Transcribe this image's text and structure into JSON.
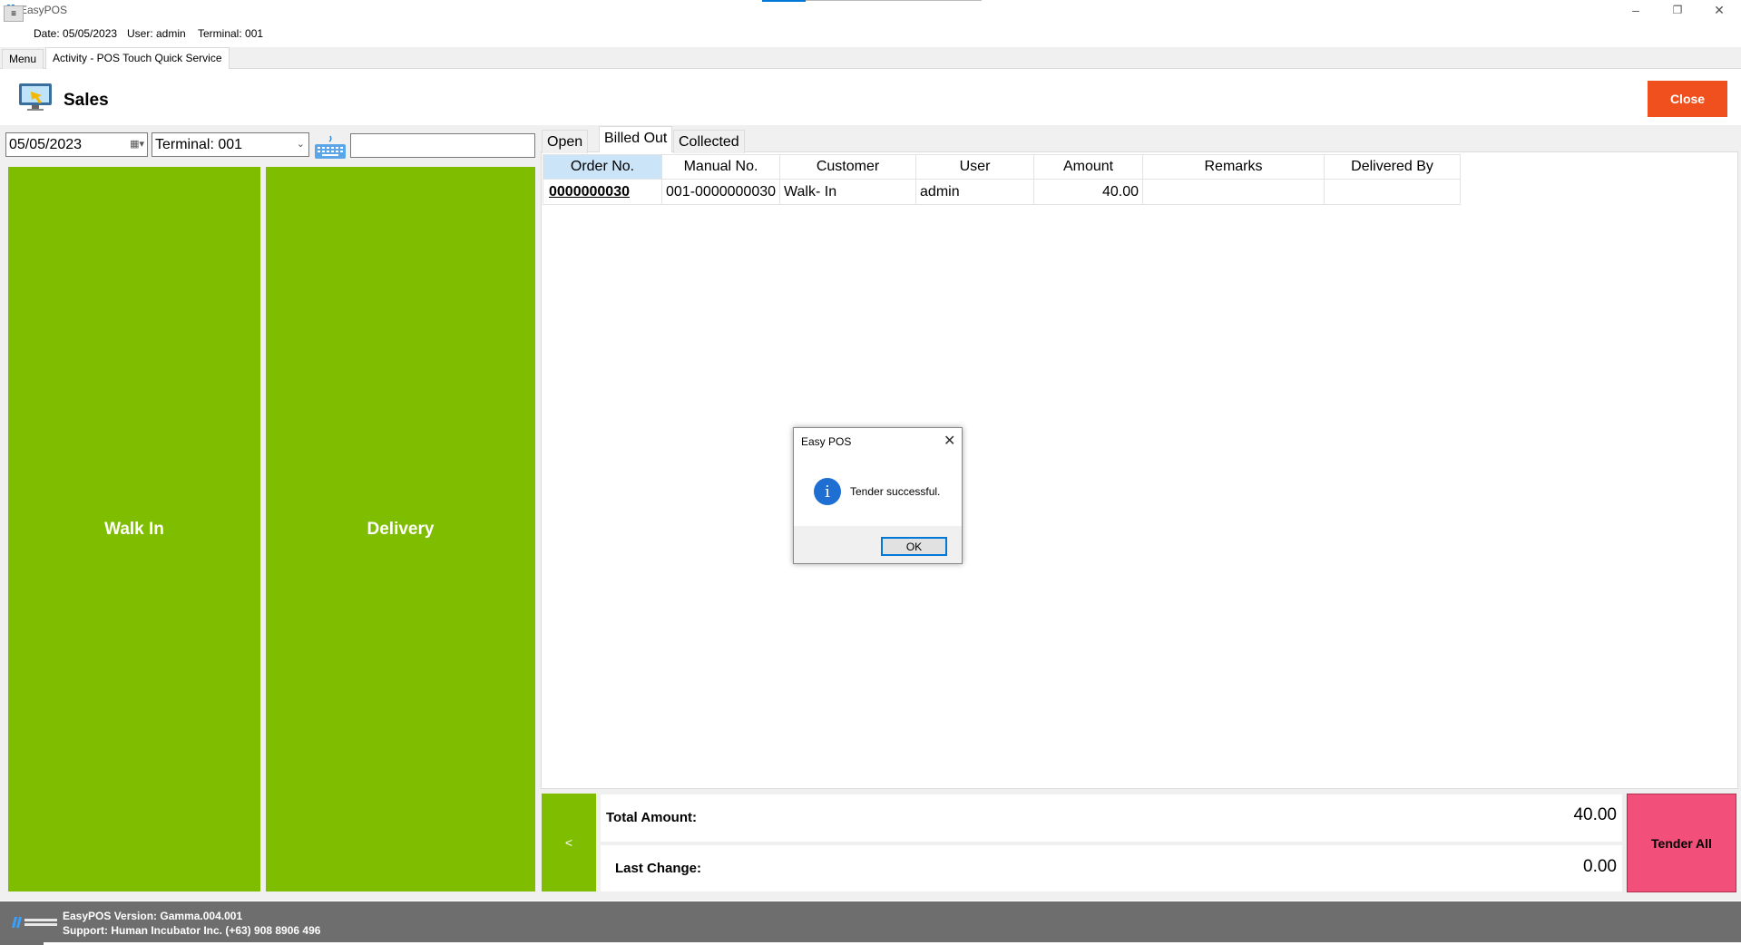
{
  "window": {
    "app_title": "EasyPOS",
    "controls": [
      "–",
      "❐",
      "✕"
    ]
  },
  "infobar": {
    "menu_glyph": "≡",
    "date": "Date: 05/05/2023",
    "user": "User: admin",
    "terminal": "Terminal: 001"
  },
  "tabs": {
    "menu": "Menu",
    "activity": "Activity - POS Touch Quick Service"
  },
  "sales": {
    "title": "Sales",
    "close_label": "Close",
    "date_value": "05/05/2023",
    "terminal_value": "Terminal: 001",
    "search_value": "",
    "walk_in_label": "Walk In",
    "delivery_label": "Delivery"
  },
  "order_tabs": {
    "open": "Open",
    "billed_out": "Billed Out",
    "collected": "Collected"
  },
  "table": {
    "headers": [
      "Order No.",
      "Manual No.",
      "Customer",
      "User",
      "Amount",
      "Remarks",
      "Delivered By"
    ],
    "rows": [
      [
        "0000000030",
        "001-0000000030",
        "Walk- In",
        "admin",
        "40.00",
        "",
        ""
      ]
    ]
  },
  "totals": {
    "back_label": "<",
    "total_amount_label": "Total Amount:",
    "total_amount_value": "40.00",
    "last_change_label": "Last Change:",
    "last_change_value": "0.00",
    "tender_all_label": "Tender All"
  },
  "status": {
    "version": "EasyPOS Version: Gamma.004.001",
    "support": "Support: Human Incubator Inc. (+63) 908 8906 496"
  },
  "dialog": {
    "title": "Easy POS",
    "close_glyph": "✕",
    "icon_glyph": "i",
    "message": "Tender successful.",
    "ok_label": "OK"
  },
  "colors": {
    "accent_green": "#7fbd00",
    "close_orange": "#f0501e",
    "tender_pink": "#f2507a",
    "header_blue": "#cce4f7"
  }
}
